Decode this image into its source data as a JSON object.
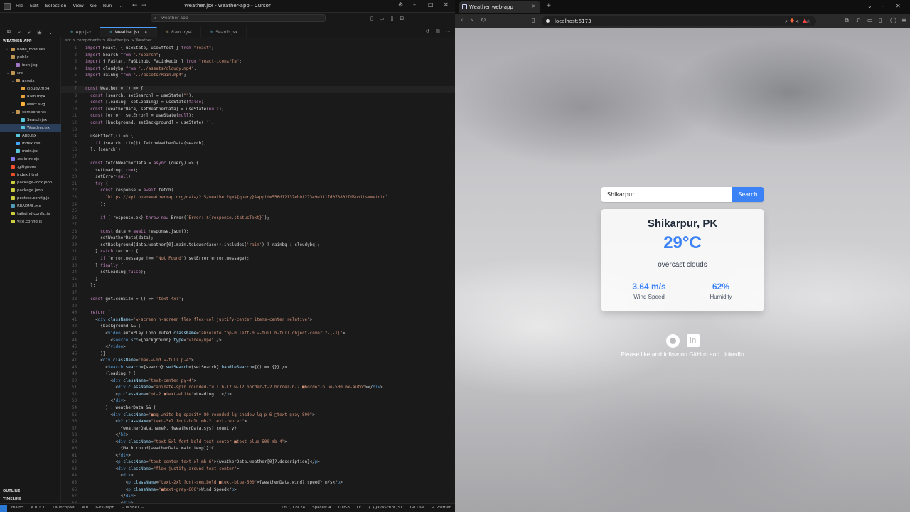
{
  "editor": {
    "window_title": "Weather.jsx - weather-app - Cursor",
    "menu": [
      "File",
      "Edit",
      "Selection",
      "View",
      "Go",
      "Run",
      "…"
    ],
    "search_placeholder": "weather-app",
    "tabs": [
      {
        "label": "App.jsx",
        "active": false
      },
      {
        "label": "Weather.jsx",
        "active": true
      },
      {
        "label": "Rain.mp4",
        "active": false
      },
      {
        "label": "Search.jsx",
        "active": false
      }
    ],
    "breadcrumb": "src  >  components  >  Weather.jsx  >  Weather",
    "explorer": {
      "title": "WEATHER-APP",
      "items": [
        {
          "label": "node_modules",
          "depth": 1,
          "type": "folder"
        },
        {
          "label": "public",
          "depth": 1,
          "type": "folder"
        },
        {
          "label": "icon.jpg",
          "depth": 2,
          "type": "img"
        },
        {
          "label": "src",
          "depth": 1,
          "type": "folder"
        },
        {
          "label": "assets",
          "depth": 2,
          "type": "folder"
        },
        {
          "label": "cloudy.mp4",
          "depth": 3,
          "type": "media"
        },
        {
          "label": "Rain.mp4",
          "depth": 3,
          "type": "media"
        },
        {
          "label": "react.svg",
          "depth": 3,
          "type": "svg"
        },
        {
          "label": "components",
          "depth": 2,
          "type": "folder"
        },
        {
          "label": "Search.jsx",
          "depth": 3,
          "type": "jsx"
        },
        {
          "label": "Weather.jsx",
          "depth": 3,
          "type": "jsx",
          "selected": true
        },
        {
          "label": "App.jsx",
          "depth": 2,
          "type": "jsx"
        },
        {
          "label": "index.css",
          "depth": 2,
          "type": "css"
        },
        {
          "label": "main.jsx",
          "depth": 2,
          "type": "jsx"
        },
        {
          "label": ".eslintrc.cjs",
          "depth": 1,
          "type": "cfg"
        },
        {
          "label": ".gitignore",
          "depth": 1,
          "type": "git"
        },
        {
          "label": "index.html",
          "depth": 1,
          "type": "html"
        },
        {
          "label": "package-lock.json",
          "depth": 1,
          "type": "json"
        },
        {
          "label": "package.json",
          "depth": 1,
          "type": "json"
        },
        {
          "label": "postcss.config.js",
          "depth": 1,
          "type": "js"
        },
        {
          "label": "README.md",
          "depth": 1,
          "type": "md"
        },
        {
          "label": "tailwind.config.js",
          "depth": 1,
          "type": "js"
        },
        {
          "label": "vite.config.js",
          "depth": 1,
          "type": "js"
        }
      ],
      "outline": "OUTLINE",
      "timeline": "TIMELINE"
    },
    "code": [
      "import React, { useState, useEffect } from \"react\";",
      "import Search from \"./Search\";",
      "import { FaStar, FaGithub, FaLinkedin } from \"react-icons/fa\";",
      "import cloudybg from \"../assets/cloudy.mp4\";",
      "import rainbg from \"../assets/Rain.mp4\";",
      "",
      "const Weather = () => {",
      "  const [search, setSearch] = useState(\"\");",
      "  const [loading, setLoading] = useState(false);",
      "  const [weatherData, setWeatherData] = useState(null);",
      "  const [error, setError] = useState(null);",
      "  const [background, setBackground] = useState('');",
      "",
      "  useEffect(() => {",
      "    if (search.trim()) fetchWeatherData(search);",
      "  }, [search]);",
      "",
      "  const fetchWeatherData = async (query) => {",
      "    setLoading(true);",
      "    setError(null);",
      "    try {",
      "      const response = await fetch(",
      "        `https://api.openweathermap.org/data/2.5/weather?q=${query}&appid=556d12137eb0f27349e311fd073802fd&units=metric`",
      "      );",
      "",
      "      if (!response.ok) throw new Error(`Error: ${response.statusText}`);",
      "",
      "      const data = await response.json();",
      "      setWeatherData(data);",
      "      setBackground(data.weather[0].main.toLowerCase().includes('rain') ? rainbg : cloudybg);",
      "    } catch (error) {",
      "      if (error.message !== \"Not Found\") setError(error.message);",
      "    } finally {",
      "      setLoading(false);",
      "    }",
      "  };",
      "",
      "  const getIconSize = () => 'text-4xl';",
      "",
      "  return (",
      "    <div className=\"w-screen h-screen flex flex-col justify-center items-center relative\">",
      "      {background && (",
      "        <video autoPlay loop muted className=\"absolute top-0 left-0 w-full h-full object-cover z-[-1]\">",
      "          <source src={background} type=\"video/mp4\" />",
      "        </video>",
      "      )}",
      "      <div className=\"max-w-md w-full p-4\">",
      "        <Search search={search} setSearch={setSearch} handleSearch={() => {}} />",
      "        {loading ? (",
      "          <div className=\"text-center py-4\">",
      "            <div className=\"animate-spin rounded-full h-12 w-12 border-t-2 border-b-2 ■border-blue-500 mx-auto\"></div>",
      "            <p className=\"mt-2 ■text-white\">Loading...</p>",
      "          </div>",
      "        ) : weatherData && (",
      "          <div className=\"■bg-white bg-opacity-80 rounded-lg shadow-lg p-6 □text-gray-800\">",
      "            <h2 className=\"text-3xl font-bold mb-2 text-center\">",
      "              {weatherData.name}, {weatherData.sys?.country}",
      "            </h2>",
      "            <div className=\"text-5xl font-bold text-center ■text-blue-500 mb-4\">",
      "              {Math.round(weatherData.main.temp)}°C",
      "            </div>",
      "            <p className=\"text-center text-xl mb-6\">{weatherData.weather[0]?.description}</p>",
      "            <div className=\"flex justify-around text-center\">",
      "              <div>",
      "                <p className=\"text-2xl font-semibold ■text-blue-500\">{weatherData.wind?.speed} m/s</p>",
      "                <p className=\"■text-gray-600\">Wind Speed</p>",
      "              </div>",
      "              <div>"
    ],
    "status": {
      "left": [
        "main*",
        "⊗ 0 ⚠ 0",
        "Launchpad",
        "⊗ 0",
        "Git Graph",
        "-- INSERT --"
      ],
      "right": [
        "Ln 7, Col 24",
        "Spaces: 4",
        "UTF-8",
        "LF",
        "{ } JavaScript JSX",
        "Go Live",
        "✓ Prettier"
      ]
    }
  },
  "browser": {
    "tab_title": "Weather web-app",
    "url": "localhost:5173",
    "app": {
      "search_value": "Shikarpur",
      "search_button": "Search",
      "city": "Shikarpur, PK",
      "temperature": "29°C",
      "description": "overcast clouds",
      "wind_value": "3.64 m/s",
      "wind_label": "Wind Speed",
      "humidity_value": "62%",
      "humidity_label": "Humidity",
      "footer_text": "Please like and follow on GitHub and LinkedIn",
      "linkedin_glyph": "in"
    }
  },
  "colors": {
    "accent": "#3b82f6",
    "editor_bg": "#1a1a1a"
  }
}
